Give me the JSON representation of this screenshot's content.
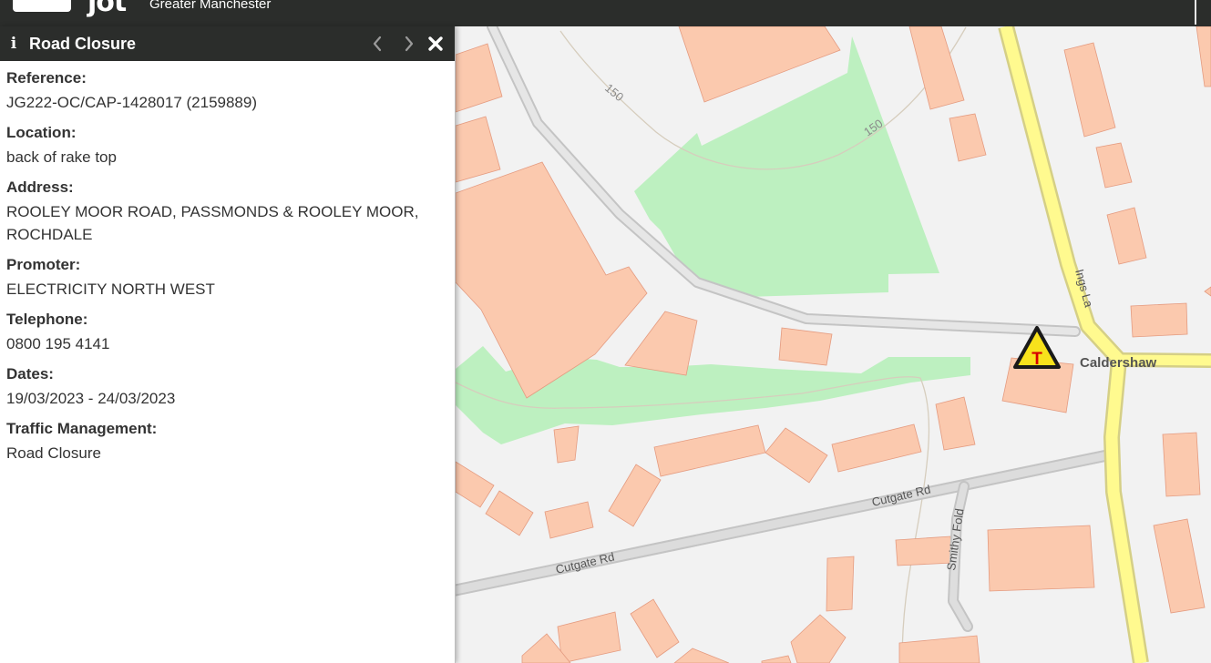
{
  "header": {
    "logo_mark": "jot",
    "logo_text": "Greater Manchester"
  },
  "panel": {
    "title": "Road Closure",
    "icons": {
      "info": "info-icon",
      "prev": "chevron-left-icon",
      "next": "chevron-right-icon",
      "close": "close-icon"
    },
    "fields": [
      {
        "label": "Reference:",
        "value": "JG222-OC/CAP-1428017 (2159889)"
      },
      {
        "label": "Location:",
        "value": "back of rake top"
      },
      {
        "label": "Address:",
        "value": "ROOLEY MOOR ROAD, PASSMONDS & ROOLEY MOOR, ROCHDALE"
      },
      {
        "label": "Promoter:",
        "value": "ELECTRICITY NORTH WEST"
      },
      {
        "label": "Telephone:",
        "value": "0800 195 4141"
      },
      {
        "label": "Dates:",
        "value": "19/03/2023 - 24/03/2023"
      },
      {
        "label": "Traffic Management:",
        "value": "Road Closure"
      }
    ]
  },
  "map": {
    "labels": {
      "contour_1": "150",
      "contour_2": "150",
      "ings_la": "Ings La",
      "caldershaw": "Caldershaw",
      "cutgate_rd_1": "Cutgate Rd",
      "cutgate_rd_2": "Cutgate Rd",
      "smithy_fold": "Smithy Fold"
    },
    "marker": {
      "icon": "road-closure-warning-icon",
      "letter": "T"
    },
    "colors": {
      "building": "#fbc9ae",
      "green": "#bdf0c0",
      "major_road": "#fffa8f",
      "minor_road": "#dddddd",
      "marker_fill": "#f8e21c"
    }
  }
}
